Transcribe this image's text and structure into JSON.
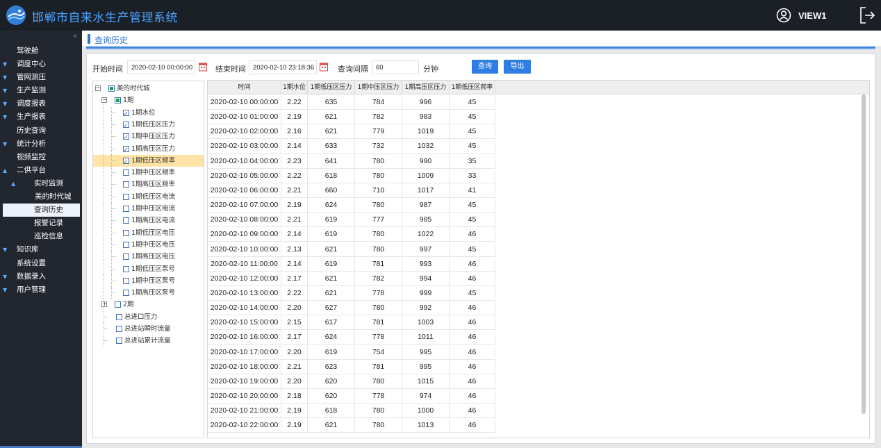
{
  "header": {
    "title": "邯郸市自来水生产管理系统",
    "user": "VIEW1"
  },
  "sidebar": {
    "collapse": "«",
    "items": [
      {
        "label": "驾驶舱",
        "arrow": "",
        "indent": 0
      },
      {
        "label": "调度中心",
        "arrow": "▼",
        "indent": 0
      },
      {
        "label": "管网测压",
        "arrow": "▼",
        "indent": 0
      },
      {
        "label": "生产监测",
        "arrow": "▼",
        "indent": 0
      },
      {
        "label": "调度报表",
        "arrow": "▼",
        "indent": 0
      },
      {
        "label": "生产报表",
        "arrow": "▼",
        "indent": 0
      },
      {
        "label": "历史查询",
        "arrow": "",
        "indent": 0
      },
      {
        "label": "统计分析",
        "arrow": "▼",
        "indent": 0
      },
      {
        "label": "视频监控",
        "arrow": "",
        "indent": 0
      },
      {
        "label": "二供平台",
        "arrow": "▲",
        "indent": 0
      },
      {
        "label": "实时监测",
        "arrow": "▲",
        "indent": 1
      },
      {
        "label": "美的时代城",
        "arrow": "",
        "indent": 2
      },
      {
        "label": "查询历史",
        "arrow": "",
        "indent": 1,
        "active": true
      },
      {
        "label": "报警记录",
        "arrow": "",
        "indent": 1
      },
      {
        "label": "巡检信息",
        "arrow": "",
        "indent": 1
      },
      {
        "label": "知识库",
        "arrow": "▼",
        "indent": 0
      },
      {
        "label": "系统设置",
        "arrow": "",
        "indent": 0
      },
      {
        "label": "数据录入",
        "arrow": "▼",
        "indent": 0
      },
      {
        "label": "用户管理",
        "arrow": "▼",
        "indent": 0
      }
    ]
  },
  "page": {
    "title": "查询历史"
  },
  "filters": {
    "start_label": "开始时间",
    "start_value": "2020-02-10 00:00:00",
    "end_label": "结束时间",
    "end_value": "2020-02-10 23:18:36",
    "interval_label": "查询间隔",
    "interval_value": "60",
    "interval_unit": "分钟",
    "query_button": "查询",
    "export_button": "导出"
  },
  "tree": [
    {
      "label": "美的时代城",
      "level": 0,
      "expander": "⊟",
      "state": "partial"
    },
    {
      "label": "1期",
      "level": 1,
      "expander": "⊖",
      "state": "partial"
    },
    {
      "label": "1期水位",
      "level": 2,
      "state": "checked"
    },
    {
      "label": "1期低压区压力",
      "level": 2,
      "state": "checked"
    },
    {
      "label": "1期中压区压力",
      "level": 2,
      "state": "checked"
    },
    {
      "label": "1期高压区压力",
      "level": 2,
      "state": "checked"
    },
    {
      "label": "1期低压区频率",
      "level": 2,
      "state": "checked",
      "selected": true
    },
    {
      "label": "1期中压区频率",
      "level": 2,
      "state": "unchecked"
    },
    {
      "label": "1期高压区频率",
      "level": 2,
      "state": "unchecked"
    },
    {
      "label": "1期低压区电流",
      "level": 2,
      "state": "unchecked"
    },
    {
      "label": "1期中压区电流",
      "level": 2,
      "state": "unchecked"
    },
    {
      "label": "1期高压区电流",
      "level": 2,
      "state": "unchecked"
    },
    {
      "label": "1期低压区电压",
      "level": 2,
      "state": "unchecked"
    },
    {
      "label": "1期中压区电压",
      "level": 2,
      "state": "unchecked"
    },
    {
      "label": "1期高压区电压",
      "level": 2,
      "state": "unchecked"
    },
    {
      "label": "1期低压区泵号",
      "level": 2,
      "state": "unchecked"
    },
    {
      "label": "1期中压区泵号",
      "level": 2,
      "state": "unchecked"
    },
    {
      "label": "1期高压区泵号",
      "level": 2,
      "state": "unchecked"
    },
    {
      "label": "2期",
      "level": 1,
      "expander": "⊕",
      "state": "unchecked"
    },
    {
      "label": "总进口压力",
      "level": 1,
      "state": "unchecked"
    },
    {
      "label": "总进站瞬时流量",
      "level": 1,
      "state": "unchecked"
    },
    {
      "label": "总进站累计流量",
      "level": 1,
      "state": "unchecked"
    }
  ],
  "table": {
    "columns": [
      "时间",
      "1期水位",
      "1期低压区压力",
      "1期中压区压力",
      "1期高压区压力",
      "1期低压区频率"
    ],
    "rows": [
      [
        "2020-02-10 00:00:00",
        "2.22",
        "635",
        "784",
        "996",
        "45"
      ],
      [
        "2020-02-10 01:00:00",
        "2.19",
        "621",
        "782",
        "983",
        "45"
      ],
      [
        "2020-02-10 02:00:00",
        "2.16",
        "621",
        "779",
        "1019",
        "45"
      ],
      [
        "2020-02-10 03:00:00",
        "2.14",
        "633",
        "732",
        "1032",
        "45"
      ],
      [
        "2020-02-10 04:00:00",
        "2.23",
        "641",
        "780",
        "990",
        "35"
      ],
      [
        "2020-02-10 05:00:00",
        "2.22",
        "618",
        "780",
        "1009",
        "33"
      ],
      [
        "2020-02-10 06:00:00",
        "2.21",
        "660",
        "710",
        "1017",
        "41"
      ],
      [
        "2020-02-10 07:00:00",
        "2.19",
        "624",
        "780",
        "987",
        "45"
      ],
      [
        "2020-02-10 08:00:00",
        "2.21",
        "619",
        "777",
        "985",
        "45"
      ],
      [
        "2020-02-10 09:00:00",
        "2.14",
        "619",
        "780",
        "1022",
        "46"
      ],
      [
        "2020-02-10 10:00:00",
        "2.13",
        "621",
        "780",
        "997",
        "45"
      ],
      [
        "2020-02-10 11:00:00",
        "2.14",
        "619",
        "781",
        "993",
        "46"
      ],
      [
        "2020-02-10 12:00:00",
        "2.17",
        "621",
        "782",
        "994",
        "46"
      ],
      [
        "2020-02-10 13:00:00",
        "2.22",
        "621",
        "778",
        "999",
        "45"
      ],
      [
        "2020-02-10 14:00:00",
        "2.20",
        "627",
        "780",
        "992",
        "46"
      ],
      [
        "2020-02-10 15:00:00",
        "2.15",
        "617",
        "781",
        "1003",
        "46"
      ],
      [
        "2020-02-10 16:00:00",
        "2.17",
        "624",
        "778",
        "1011",
        "46"
      ],
      [
        "2020-02-10 17:00:00",
        "2.20",
        "619",
        "754",
        "995",
        "46"
      ],
      [
        "2020-02-10 18:00:00",
        "2.21",
        "623",
        "781",
        "995",
        "46"
      ],
      [
        "2020-02-10 19:00:00",
        "2.20",
        "620",
        "780",
        "1015",
        "46"
      ],
      [
        "2020-02-10 20:00:00",
        "2.18",
        "620",
        "778",
        "974",
        "46"
      ],
      [
        "2020-02-10 21:00:00",
        "2.19",
        "618",
        "780",
        "1000",
        "46"
      ],
      [
        "2020-02-10 22:00:00",
        "2.19",
        "621",
        "780",
        "1013",
        "46"
      ]
    ]
  }
}
